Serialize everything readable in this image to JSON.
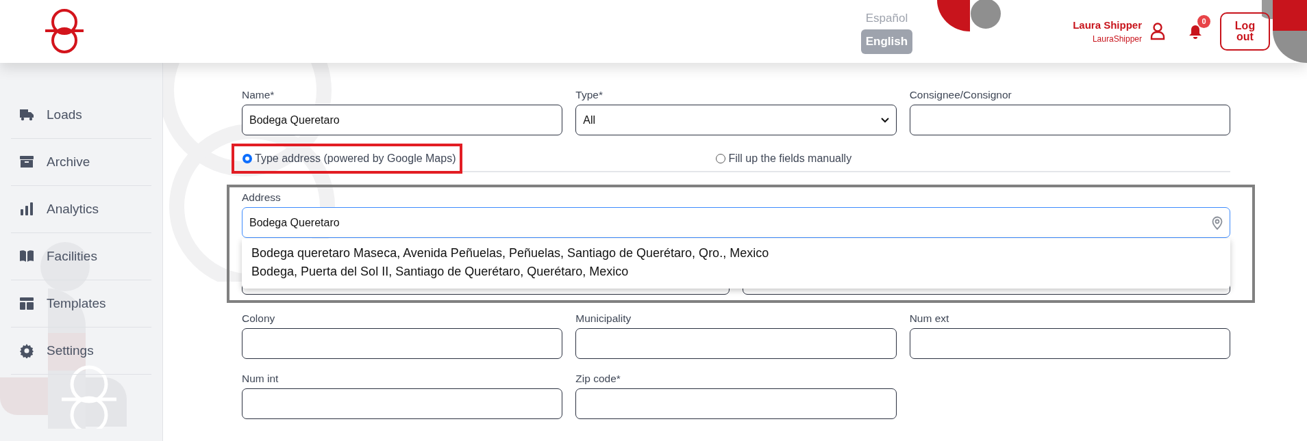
{
  "header": {
    "languages": [
      {
        "label": "Español",
        "selected": false
      },
      {
        "label": "English",
        "selected": true
      }
    ],
    "user": {
      "name": "Laura Shipper",
      "username": "LauraShipper"
    },
    "notifications": {
      "count": "0"
    },
    "logout": "Log out"
  },
  "sidebar": {
    "items": [
      {
        "label": "Loads"
      },
      {
        "label": "Archive"
      },
      {
        "label": "Analytics"
      },
      {
        "label": "Facilities"
      },
      {
        "label": "Templates"
      },
      {
        "label": "Settings"
      }
    ]
  },
  "form": {
    "top_fields": [
      {
        "label": "Name*",
        "kind": "text",
        "value": "Bodega Queretaro"
      },
      {
        "label": "Type*",
        "kind": "select",
        "value": "All"
      },
      {
        "label": "Consignee/Consignor",
        "kind": "text"
      }
    ],
    "address_modes": [
      {
        "label": "Type address (powered by Google Maps)",
        "selected": true,
        "highlighted": true
      },
      {
        "label": "Fill up the fields manually",
        "selected": false,
        "highlighted": false
      }
    ],
    "address": {
      "label": "Address",
      "value": "Bodega Queretaro",
      "suggestions": [
        "Bodega queretaro Maseca, Avenida Peñuelas, Peñuelas, Santiago de Querétaro, Qro., Mexico",
        "Bodega, Puerta del Sol II, Santiago de Querétaro, Querétaro, Mexico"
      ]
    },
    "rows": [
      [
        {
          "label": "Colony"
        },
        {
          "label": "Municipality"
        },
        {
          "label": "Num ext"
        }
      ],
      [
        {
          "label": "Num int"
        },
        {
          "label": "Zip code*"
        }
      ]
    ]
  }
}
